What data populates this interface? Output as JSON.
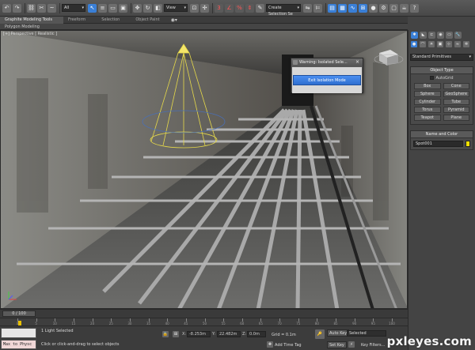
{
  "toolbar": {
    "selection_filter": "All",
    "reference_coord": "View",
    "named_selection_placeholder": "Create Selection Se",
    "icons": [
      "undo-icon",
      "redo-icon",
      "link-icon",
      "unlink-icon",
      "bind-icon",
      "select-icon",
      "select-by-name-icon",
      "region-select-icon",
      "window-crossing-icon",
      "move-icon",
      "rotate-icon",
      "scale-icon",
      "pivot-icon",
      "select-manipulate-icon",
      "snaps-icon",
      "angle-snap-icon",
      "percent-snap-icon",
      "spinner-snap-icon",
      "edit-named-selection-icon",
      "mirror-icon",
      "align-icon",
      "layer-manager-icon",
      "graphite-ribbon-icon",
      "curve-editor-icon",
      "schematic-view-icon",
      "material-editor-icon",
      "render-setup-icon",
      "rendered-frame-icon",
      "render-icon",
      "help-icon"
    ]
  },
  "ribbon": {
    "tabs": [
      "Graphite Modeling Tools",
      "Freeform",
      "Selection",
      "Object Paint"
    ],
    "panel_label": "Polygon Modeling"
  },
  "viewport": {
    "label": "[+] Perspective [ Realistic ]"
  },
  "dialog": {
    "title": "Warning: Isolated Sele...",
    "button": "Exit Isolation Mode"
  },
  "command_panel": {
    "category": "Standard Primitives",
    "object_type": {
      "heading": "Object Type",
      "autogrid": "AutoGrid",
      "buttons": [
        "Box",
        "Cone",
        "Sphere",
        "GeoSphere",
        "Cylinder",
        "Tube",
        "Torus",
        "Pyramid",
        "Teapot",
        "Plane"
      ]
    },
    "name_and_color": {
      "heading": "Name and Color",
      "name": "Spot001",
      "color": "#f0e000"
    }
  },
  "timeline": {
    "frame_display": "0 / 100",
    "ticks": [
      "0",
      "5",
      "10",
      "15",
      "20",
      "25",
      "30",
      "35",
      "40",
      "45",
      "50",
      "55",
      "60",
      "65",
      "70",
      "75",
      "80",
      "85",
      "90",
      "95",
      "100"
    ]
  },
  "status_bar": {
    "selection_info": "1 Light Selected",
    "prompt": "Click or click-and-drag to select objects",
    "script_text": "Max to Physc",
    "coord_x_label": "X:",
    "coord_x": "-8.253m",
    "coord_y_label": "Y:",
    "coord_y": "22.482m",
    "coord_z_label": "Z:",
    "coord_z": "0.0m",
    "grid": "Grid = 0.1m",
    "add_time_tag": "Add Time Tag",
    "auto_key": "Auto Key",
    "set_key": "Set Key",
    "key_mode": "Selected",
    "key_filters": "Key Filters..."
  },
  "watermark": "pxleyes.com"
}
